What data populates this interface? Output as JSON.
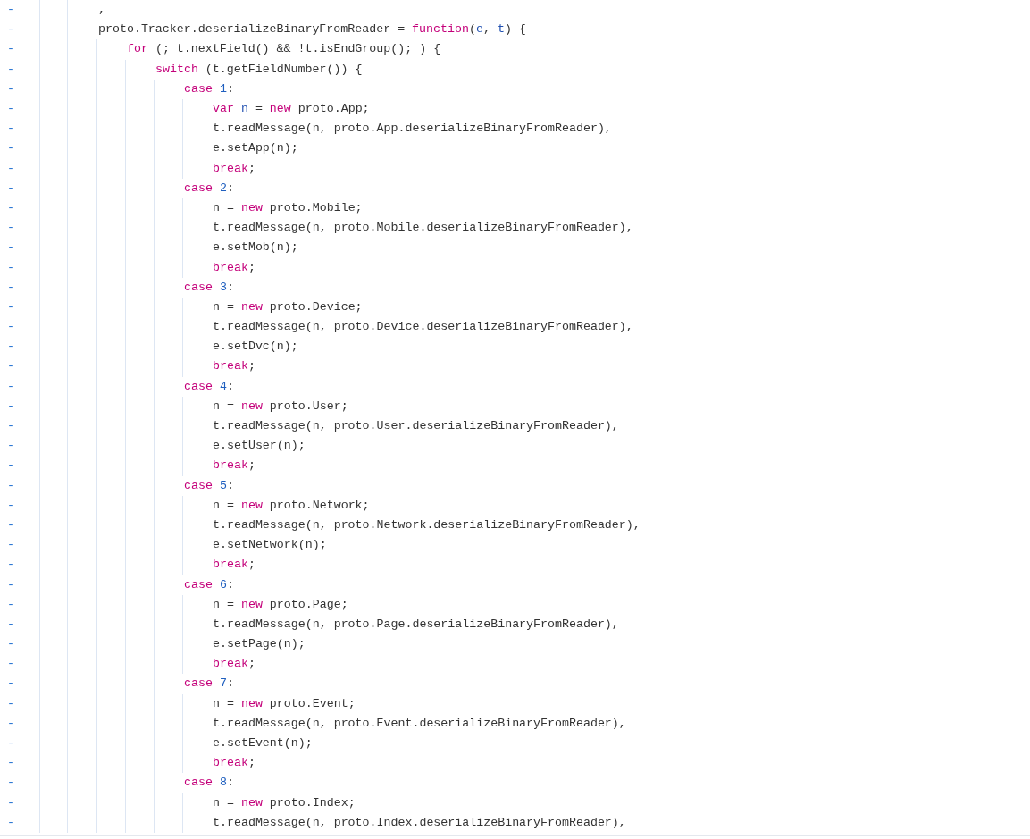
{
  "lines": [
    {
      "marker": "-",
      "tokens": [
        {
          "kind": "plain",
          "text": ","
        }
      ]
    },
    {
      "marker": "-",
      "tokens": [
        {
          "kind": "plain",
          "text": "proto.Tracker.deserializeBinaryFromReader = "
        },
        {
          "kind": "keyword",
          "text": "function"
        },
        {
          "kind": "plain",
          "text": "("
        },
        {
          "kind": "variable",
          "text": "e"
        },
        {
          "kind": "plain",
          "text": ", "
        },
        {
          "kind": "variable",
          "text": "t"
        },
        {
          "kind": "plain",
          "text": ") {"
        }
      ],
      "children": [
        {
          "marker": "-",
          "tokens": [
            {
              "kind": "keyword",
              "text": "for"
            },
            {
              "kind": "plain",
              "text": " (; t.nextField() && !t.isEndGroup(); ) {"
            }
          ],
          "children": [
            {
              "marker": "-",
              "tokens": [
                {
                  "kind": "keyword",
                  "text": "switch"
                },
                {
                  "kind": "plain",
                  "text": " (t.getFieldNumber()) {"
                }
              ],
              "children": [
                {
                  "marker": "-",
                  "tokens": [
                    {
                      "kind": "keyword",
                      "text": "case "
                    },
                    {
                      "kind": "number",
                      "text": "1"
                    },
                    {
                      "kind": "plain",
                      "text": ":"
                    }
                  ],
                  "children": [
                    {
                      "marker": "-",
                      "tokens": [
                        {
                          "kind": "keyword",
                          "text": "var "
                        },
                        {
                          "kind": "variable",
                          "text": "n"
                        },
                        {
                          "kind": "plain",
                          "text": " = "
                        },
                        {
                          "kind": "keyword",
                          "text": "new"
                        },
                        {
                          "kind": "plain",
                          "text": " proto.App;"
                        }
                      ]
                    },
                    {
                      "marker": "-",
                      "tokens": [
                        {
                          "kind": "plain",
                          "text": "t.readMessage(n, proto.App.deserializeBinaryFromReader),"
                        }
                      ]
                    },
                    {
                      "marker": "-",
                      "tokens": [
                        {
                          "kind": "plain",
                          "text": "e.setApp(n);"
                        }
                      ]
                    },
                    {
                      "marker": "-",
                      "tokens": [
                        {
                          "kind": "keyword",
                          "text": "break"
                        },
                        {
                          "kind": "plain",
                          "text": ";"
                        }
                      ]
                    }
                  ]
                },
                {
                  "marker": "-",
                  "tokens": [
                    {
                      "kind": "keyword",
                      "text": "case "
                    },
                    {
                      "kind": "number",
                      "text": "2"
                    },
                    {
                      "kind": "plain",
                      "text": ":"
                    }
                  ],
                  "children": [
                    {
                      "marker": "-",
                      "tokens": [
                        {
                          "kind": "plain",
                          "text": "n = "
                        },
                        {
                          "kind": "keyword",
                          "text": "new"
                        },
                        {
                          "kind": "plain",
                          "text": " proto.Mobile;"
                        }
                      ]
                    },
                    {
                      "marker": "-",
                      "tokens": [
                        {
                          "kind": "plain",
                          "text": "t.readMessage(n, proto.Mobile.deserializeBinaryFromReader),"
                        }
                      ]
                    },
                    {
                      "marker": "-",
                      "tokens": [
                        {
                          "kind": "plain",
                          "text": "e.setMob(n);"
                        }
                      ]
                    },
                    {
                      "marker": "-",
                      "tokens": [
                        {
                          "kind": "keyword",
                          "text": "break"
                        },
                        {
                          "kind": "plain",
                          "text": ";"
                        }
                      ]
                    }
                  ]
                },
                {
                  "marker": "-",
                  "tokens": [
                    {
                      "kind": "keyword",
                      "text": "case "
                    },
                    {
                      "kind": "number",
                      "text": "3"
                    },
                    {
                      "kind": "plain",
                      "text": ":"
                    }
                  ],
                  "children": [
                    {
                      "marker": "-",
                      "tokens": [
                        {
                          "kind": "plain",
                          "text": "n = "
                        },
                        {
                          "kind": "keyword",
                          "text": "new"
                        },
                        {
                          "kind": "plain",
                          "text": " proto.Device;"
                        }
                      ]
                    },
                    {
                      "marker": "-",
                      "tokens": [
                        {
                          "kind": "plain",
                          "text": "t.readMessage(n, proto.Device.deserializeBinaryFromReader),"
                        }
                      ]
                    },
                    {
                      "marker": "-",
                      "tokens": [
                        {
                          "kind": "plain",
                          "text": "e.setDvc(n);"
                        }
                      ]
                    },
                    {
                      "marker": "-",
                      "tokens": [
                        {
                          "kind": "keyword",
                          "text": "break"
                        },
                        {
                          "kind": "plain",
                          "text": ";"
                        }
                      ]
                    }
                  ]
                },
                {
                  "marker": "-",
                  "tokens": [
                    {
                      "kind": "keyword",
                      "text": "case "
                    },
                    {
                      "kind": "number",
                      "text": "4"
                    },
                    {
                      "kind": "plain",
                      "text": ":"
                    }
                  ],
                  "children": [
                    {
                      "marker": "-",
                      "tokens": [
                        {
                          "kind": "plain",
                          "text": "n = "
                        },
                        {
                          "kind": "keyword",
                          "text": "new"
                        },
                        {
                          "kind": "plain",
                          "text": " proto.User;"
                        }
                      ]
                    },
                    {
                      "marker": "-",
                      "tokens": [
                        {
                          "kind": "plain",
                          "text": "t.readMessage(n, proto.User.deserializeBinaryFromReader),"
                        }
                      ]
                    },
                    {
                      "marker": "-",
                      "tokens": [
                        {
                          "kind": "plain",
                          "text": "e.setUser(n);"
                        }
                      ]
                    },
                    {
                      "marker": "-",
                      "tokens": [
                        {
                          "kind": "keyword",
                          "text": "break"
                        },
                        {
                          "kind": "plain",
                          "text": ";"
                        }
                      ]
                    }
                  ]
                },
                {
                  "marker": "-",
                  "tokens": [
                    {
                      "kind": "keyword",
                      "text": "case "
                    },
                    {
                      "kind": "number",
                      "text": "5"
                    },
                    {
                      "kind": "plain",
                      "text": ":"
                    }
                  ],
                  "children": [
                    {
                      "marker": "-",
                      "tokens": [
                        {
                          "kind": "plain",
                          "text": "n = "
                        },
                        {
                          "kind": "keyword",
                          "text": "new"
                        },
                        {
                          "kind": "plain",
                          "text": " proto.Network;"
                        }
                      ]
                    },
                    {
                      "marker": "-",
                      "tokens": [
                        {
                          "kind": "plain",
                          "text": "t.readMessage(n, proto.Network.deserializeBinaryFromReader),"
                        }
                      ]
                    },
                    {
                      "marker": "-",
                      "tokens": [
                        {
                          "kind": "plain",
                          "text": "e.setNetwork(n);"
                        }
                      ]
                    },
                    {
                      "marker": "-",
                      "tokens": [
                        {
                          "kind": "keyword",
                          "text": "break"
                        },
                        {
                          "kind": "plain",
                          "text": ";"
                        }
                      ]
                    }
                  ]
                },
                {
                  "marker": "-",
                  "tokens": [
                    {
                      "kind": "keyword",
                      "text": "case "
                    },
                    {
                      "kind": "number",
                      "text": "6"
                    },
                    {
                      "kind": "plain",
                      "text": ":"
                    }
                  ],
                  "children": [
                    {
                      "marker": "-",
                      "tokens": [
                        {
                          "kind": "plain",
                          "text": "n = "
                        },
                        {
                          "kind": "keyword",
                          "text": "new"
                        },
                        {
                          "kind": "plain",
                          "text": " proto.Page;"
                        }
                      ]
                    },
                    {
                      "marker": "-",
                      "tokens": [
                        {
                          "kind": "plain",
                          "text": "t.readMessage(n, proto.Page.deserializeBinaryFromReader),"
                        }
                      ]
                    },
                    {
                      "marker": "-",
                      "tokens": [
                        {
                          "kind": "plain",
                          "text": "e.setPage(n);"
                        }
                      ]
                    },
                    {
                      "marker": "-",
                      "tokens": [
                        {
                          "kind": "keyword",
                          "text": "break"
                        },
                        {
                          "kind": "plain",
                          "text": ";"
                        }
                      ]
                    }
                  ]
                },
                {
                  "marker": "-",
                  "tokens": [
                    {
                      "kind": "keyword",
                      "text": "case "
                    },
                    {
                      "kind": "number",
                      "text": "7"
                    },
                    {
                      "kind": "plain",
                      "text": ":"
                    }
                  ],
                  "children": [
                    {
                      "marker": "-",
                      "tokens": [
                        {
                          "kind": "plain",
                          "text": "n = "
                        },
                        {
                          "kind": "keyword",
                          "text": "new"
                        },
                        {
                          "kind": "plain",
                          "text": " proto.Event;"
                        }
                      ]
                    },
                    {
                      "marker": "-",
                      "tokens": [
                        {
                          "kind": "plain",
                          "text": "t.readMessage(n, proto.Event.deserializeBinaryFromReader),"
                        }
                      ]
                    },
                    {
                      "marker": "-",
                      "tokens": [
                        {
                          "kind": "plain",
                          "text": "e.setEvent(n);"
                        }
                      ]
                    },
                    {
                      "marker": "-",
                      "tokens": [
                        {
                          "kind": "keyword",
                          "text": "break"
                        },
                        {
                          "kind": "plain",
                          "text": ";"
                        }
                      ]
                    }
                  ]
                },
                {
                  "marker": "-",
                  "tokens": [
                    {
                      "kind": "keyword",
                      "text": "case "
                    },
                    {
                      "kind": "number",
                      "text": "8"
                    },
                    {
                      "kind": "plain",
                      "text": ":"
                    }
                  ],
                  "children": [
                    {
                      "marker": "-",
                      "tokens": [
                        {
                          "kind": "plain",
                          "text": "n = "
                        },
                        {
                          "kind": "keyword",
                          "text": "new"
                        },
                        {
                          "kind": "plain",
                          "text": " proto.Index;"
                        }
                      ]
                    },
                    {
                      "marker": "-",
                      "tokens": [
                        {
                          "kind": "plain",
                          "text": "t.readMessage(n, proto.Index.deserializeBinaryFromReader),"
                        }
                      ]
                    }
                  ]
                }
              ]
            }
          ]
        }
      ]
    }
  ]
}
